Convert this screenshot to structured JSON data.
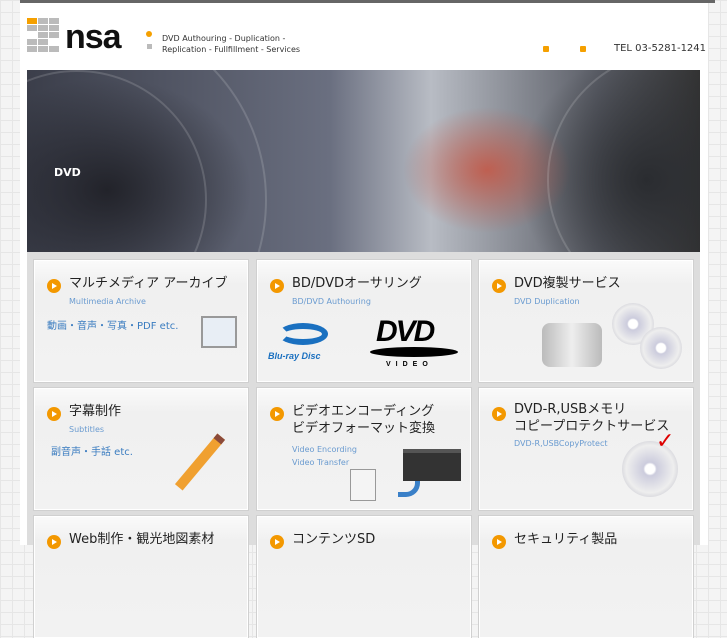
{
  "header": {
    "logo_text": "nsa",
    "tagline_1": "DVD Authouring - Duplication -",
    "tagline_2": "Replication - Fullfillment - Services",
    "tel": "TEL 03-5281-1241"
  },
  "banner": {
    "text": "DVD"
  },
  "cards": [
    {
      "title": "マルチメディア アーカイブ",
      "subtitle": "Multimedia Archive",
      "desc": "動画・音声・写真・PDF etc."
    },
    {
      "title": "BD/DVDオーサリング",
      "subtitle": "BD/DVD Authouring",
      "bluray": "Blu-ray Disc",
      "dvd": "DVD",
      "video": "VIDEO"
    },
    {
      "title": "DVD複製サービス",
      "subtitle": "DVD Duplication"
    },
    {
      "title": "字幕制作",
      "subtitle": "Subtitles",
      "desc": "副音声・手話 etc."
    },
    {
      "title": "ビデオエンコーディング\nビデオフォーマット変換",
      "title1": "ビデオエンコーディング",
      "title2": "ビデオフォーマット変換",
      "subtitle1": "Video Encording",
      "subtitle2": "Video Transfer"
    },
    {
      "title1": "DVD-R,USBメモリ",
      "title2": "コピープロテクトサービス",
      "subtitle": "DVD-R,USBCopyProtect"
    },
    {
      "title": "Web制作・観光地図素材"
    },
    {
      "title": "コンテンツSD"
    },
    {
      "title": "セキュリティ製品"
    }
  ]
}
